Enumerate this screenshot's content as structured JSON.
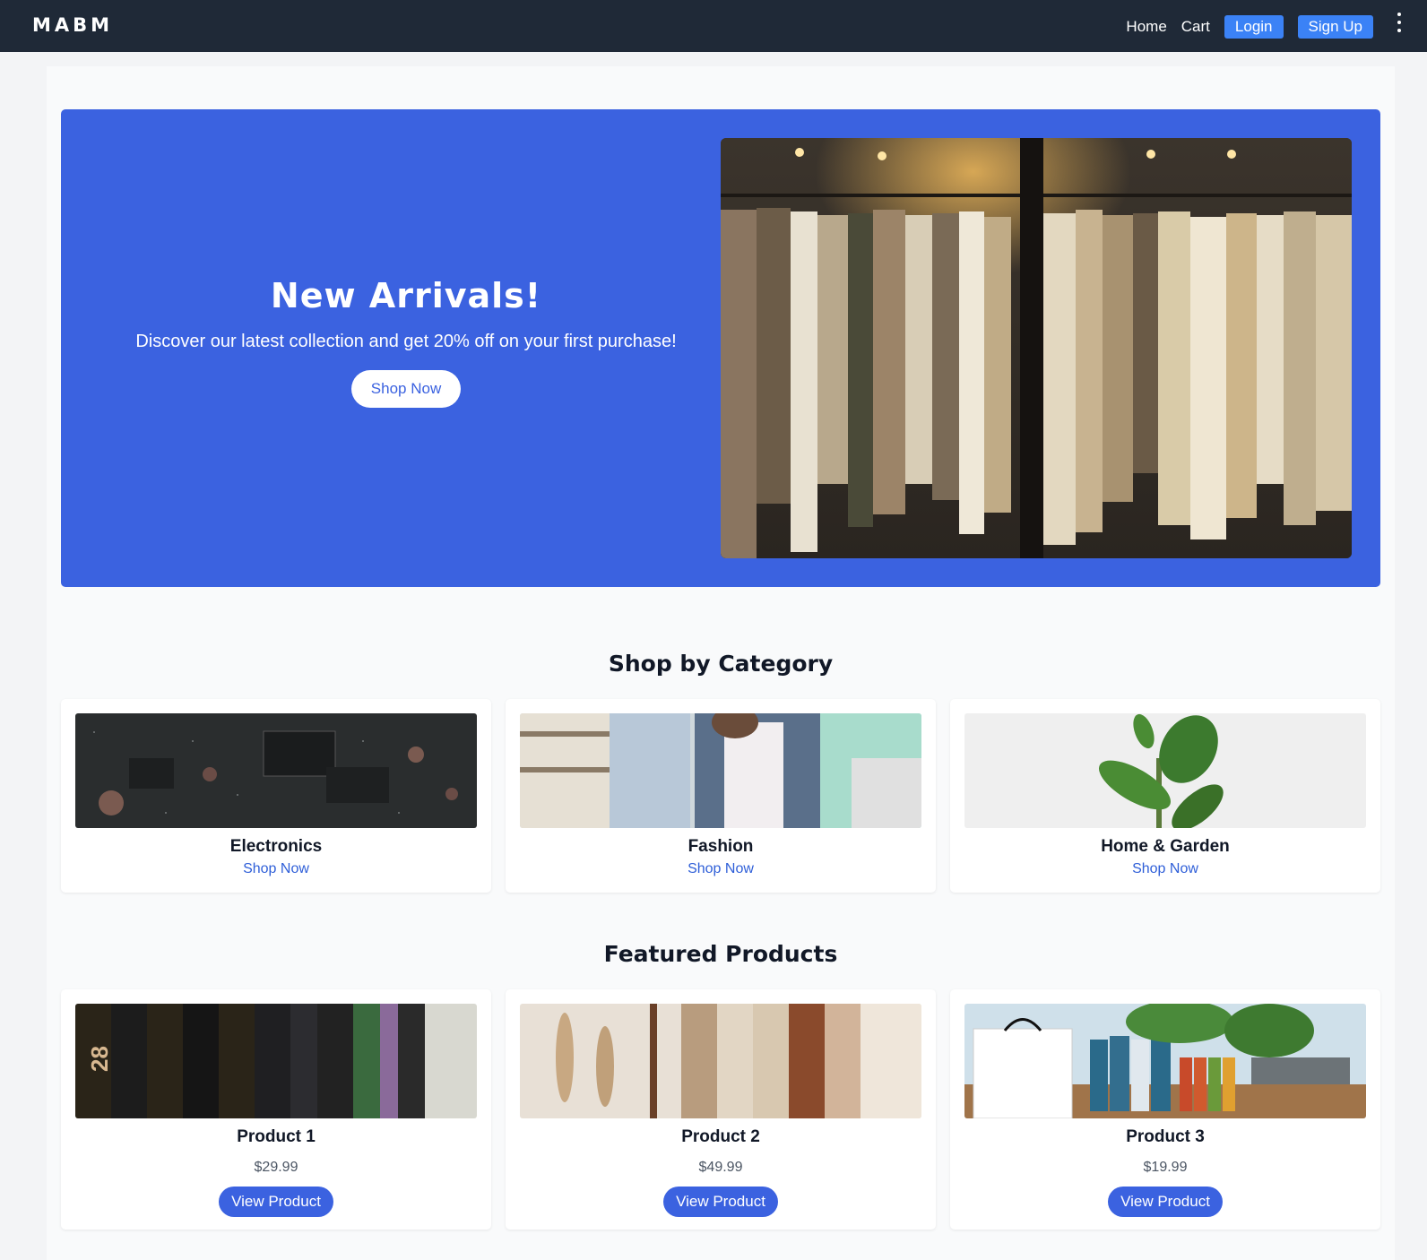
{
  "header": {
    "logo": "MABM",
    "nav": {
      "home": "Home",
      "cart": "Cart",
      "login": "Login",
      "signup": "Sign Up"
    }
  },
  "hero": {
    "title": "New Arrivals!",
    "subtitle": "Discover our latest collection and get 20% off on your first purchase!",
    "button": "Shop Now",
    "image": "clothing-rack-photo"
  },
  "categories": {
    "title": "Shop by Category",
    "items": [
      {
        "name": "Electronics",
        "link": "Shop Now",
        "image": "circuit-board-photo"
      },
      {
        "name": "Fashion",
        "link": "Shop Now",
        "image": "denim-jacket-photo"
      },
      {
        "name": "Home & Garden",
        "link": "Shop Now",
        "image": "potted-plant-photo"
      }
    ]
  },
  "featured": {
    "title": "Featured Products",
    "items": [
      {
        "name": "Product 1",
        "price": "$29.99",
        "button": "View Product",
        "image": "hair-products-photo"
      },
      {
        "name": "Product 2",
        "price": "$49.99",
        "button": "View Product",
        "image": "knit-sweaters-photo"
      },
      {
        "name": "Product 3",
        "price": "$19.99",
        "button": "View Product",
        "image": "skincare-display-photo"
      }
    ]
  },
  "colors": {
    "navbar": "#1f2937",
    "accent": "#3b62e0",
    "nav_button": "#3b82f6",
    "link": "#2f5fd8"
  }
}
